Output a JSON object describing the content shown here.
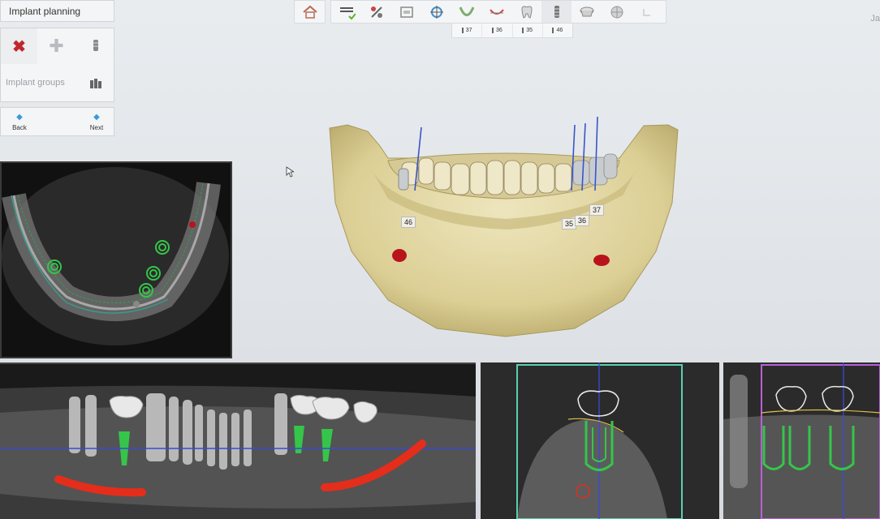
{
  "app": {
    "corner_text": "Ja"
  },
  "left_panel": {
    "title": "Implant planning",
    "group_label": "Implant groups",
    "back_label": "Back",
    "next_label": "Next"
  },
  "toolbar": {
    "buttons": [
      "home-icon",
      "list-check-icon",
      "tools-icon",
      "screen-icon",
      "cross-section-icon",
      "arch-icon",
      "curve-icon",
      "tooth-icon",
      "implant-icon",
      "crown-icon",
      "sphere-icon",
      "undo-icon"
    ]
  },
  "implant_tabs": [
    "37",
    "36",
    "35",
    "46"
  ],
  "scene": {
    "labels": {
      "l46": "46",
      "l35": "35",
      "l36": "36",
      "l37": "37"
    }
  },
  "colors": {
    "accent": "#3a9ad9",
    "bone": "#e6dcaa",
    "nerve": "#e52d1b",
    "implant": "#2fc44a",
    "crown": "#dcdcdc"
  }
}
